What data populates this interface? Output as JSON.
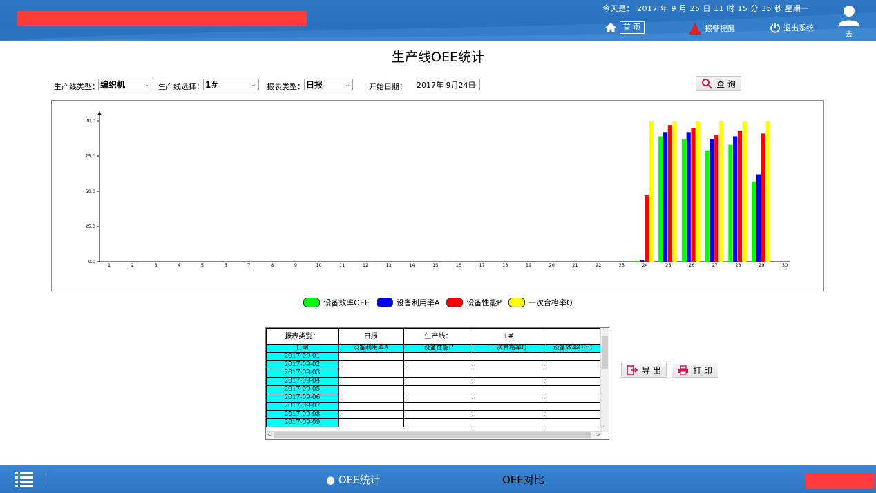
{
  "header": {
    "datetime": "今天是： 2017 年 9 月 25 日  11 时 15 分 35 秒    星期一",
    "home_label": "首 页",
    "alarm_label": "报警提醒",
    "exit_label": "退出系统",
    "user_name": "去",
    "colors": {
      "bar": "#2a72c0",
      "redaction": "#ff3b3b"
    },
    "icons": [
      "home-icon",
      "alarm-icon",
      "power-icon",
      "user-icon"
    ]
  },
  "page": {
    "title": "生产线OEE统计"
  },
  "filters": {
    "line_type_label": "生产线类型：",
    "line_type_value": "编织机",
    "line_select_label": "生产线选择：",
    "line_select_value": "1#",
    "report_type_label": "报表类型：",
    "report_type_value": "日报",
    "start_date_label": "开始日期：",
    "start_date_value": "2017年  9月24日",
    "query_label": "查 询"
  },
  "chart_data": {
    "type": "bar",
    "categories": [
      "1",
      "2",
      "3",
      "4",
      "5",
      "6",
      "7",
      "8",
      "9",
      "10",
      "11",
      "12",
      "13",
      "14",
      "15",
      "16",
      "17",
      "18",
      "19",
      "20",
      "21",
      "22",
      "23",
      "24",
      "25",
      "26",
      "27",
      "28",
      "29",
      "30"
    ],
    "y_ticks": [
      "0.0",
      "25.0",
      "50.0",
      "75.0",
      "100.0"
    ],
    "ylim": [
      0,
      100
    ],
    "grid": false,
    "legend_position": "bottom",
    "series": [
      {
        "name": "设备效率OEE",
        "color": "#00ff00",
        "values": [
          0,
          0,
          0,
          0,
          0,
          0,
          0,
          0,
          0,
          0,
          0,
          0,
          0,
          0,
          0,
          0,
          0,
          0,
          0,
          0,
          0,
          0,
          0,
          0.5,
          89,
          87,
          79,
          83,
          57,
          0
        ]
      },
      {
        "name": "设备利用率A",
        "color": "#0000ff",
        "values": [
          0,
          0,
          0,
          0,
          0,
          0,
          0,
          0,
          0,
          0,
          0,
          0,
          0,
          0,
          0,
          0,
          0,
          0,
          0,
          0,
          0,
          0,
          0,
          1,
          92,
          92,
          87,
          89,
          62,
          0
        ]
      },
      {
        "name": "设备性能P",
        "color": "#ff0000",
        "values": [
          0,
          0,
          0,
          0,
          0,
          0,
          0,
          0,
          0,
          0,
          0,
          0,
          0,
          0,
          0,
          0,
          0,
          0,
          0,
          0,
          0,
          0,
          0,
          47,
          97,
          95,
          90,
          93,
          91,
          0
        ]
      },
      {
        "name": "一次合格率Q",
        "color": "#ffff00",
        "values": [
          0,
          0,
          0,
          0,
          0,
          0,
          0,
          0,
          0,
          0,
          0,
          0,
          0,
          0,
          0,
          0,
          0,
          0,
          0,
          0,
          0,
          0,
          0,
          100,
          100,
          100,
          100,
          100,
          100,
          0
        ]
      }
    ]
  },
  "table": {
    "head": [
      "报表类别：",
      "日报",
      "生产线：",
      "1#",
      ""
    ],
    "columns": [
      "日期",
      "设备利用率A",
      "设备性能P",
      "一次合格率Q",
      "设备效率OEE"
    ],
    "rows": [
      "2017-09-01",
      "2017-09-02",
      "2017-09-03",
      "2017-09-04",
      "2017-09-05",
      "2017-09-06",
      "2017-09-07",
      "2017-09-08",
      "2017-09-09"
    ]
  },
  "actions": {
    "export_label": "导 出",
    "print_label": "打 印"
  },
  "footer": {
    "tabs": [
      {
        "label": "● OEE统计",
        "active": true
      },
      {
        "label": "OEE对比",
        "active": false
      }
    ]
  }
}
